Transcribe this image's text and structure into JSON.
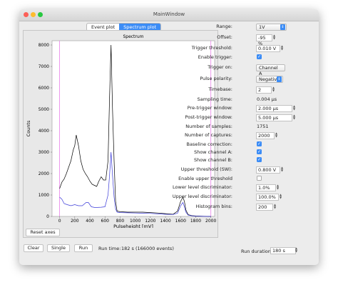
{
  "window": {
    "title": "MainWindow"
  },
  "tabs": [
    {
      "label": "Event plot",
      "active": false
    },
    {
      "label": "Spectrum plot",
      "active": true
    }
  ],
  "chart_data": {
    "type": "line",
    "title": "Spectrum",
    "xlabel": "Pulseheight [mV]",
    "ylabel": "Counts",
    "xlim": [
      -100,
      2050
    ],
    "ylim": [
      0,
      8200
    ],
    "xticks": [
      "0",
      "200",
      "400",
      "600",
      "800",
      "1000",
      "1200",
      "1400",
      "1600",
      "1800",
      "2000"
    ],
    "yticks": [
      "0",
      "1000",
      "2000",
      "3000",
      "4000",
      "5000",
      "6000",
      "7000",
      "8000"
    ],
    "markers": [
      0,
      2000
    ],
    "series": [
      {
        "color": "#000000",
        "x": [
          0,
          30,
          60,
          90,
          120,
          150,
          180,
          200,
          220,
          250,
          280,
          310,
          340,
          370,
          400,
          430,
          460,
          490,
          520,
          550,
          580,
          610,
          640,
          660,
          680,
          700,
          720,
          740,
          760,
          800,
          900,
          1000,
          1100,
          1200,
          1300,
          1400,
          1500,
          1560,
          1600,
          1630,
          1650,
          1670,
          1700,
          1750,
          1800,
          1900,
          2000
        ],
        "y": [
          1300,
          1600,
          1750,
          2000,
          2300,
          2600,
          3100,
          3300,
          3800,
          3300,
          2600,
          2200,
          2000,
          1850,
          1650,
          1500,
          1450,
          1400,
          1650,
          1850,
          1700,
          1700,
          2600,
          5500,
          8000,
          5000,
          2600,
          700,
          250,
          220,
          200,
          200,
          200,
          180,
          160,
          130,
          100,
          250,
          700,
          900,
          700,
          300,
          80,
          40,
          20,
          10,
          0
        ]
      },
      {
        "color": "#3a3ad8",
        "x": [
          0,
          30,
          60,
          100,
          150,
          200,
          250,
          300,
          350,
          380,
          420,
          460,
          500,
          550,
          600,
          640,
          660,
          680,
          700,
          720,
          740,
          760,
          800,
          900,
          1000,
          1100,
          1200,
          1300,
          1400,
          1500,
          1560,
          1600,
          1630,
          1650,
          1670,
          1700,
          1750,
          1800,
          1900,
          2000
        ],
        "y": [
          900,
          800,
          600,
          550,
          500,
          550,
          500,
          500,
          650,
          650,
          450,
          420,
          420,
          430,
          450,
          1000,
          1900,
          3000,
          1900,
          900,
          350,
          200,
          180,
          170,
          160,
          150,
          140,
          120,
          100,
          90,
          150,
          500,
          650,
          450,
          200,
          60,
          30,
          15,
          5,
          0
        ]
      }
    ]
  },
  "plot_buttons": {
    "reset_axes": "Reset axes"
  },
  "bottom": {
    "clear": "Clear",
    "single": "Single",
    "run": "Run",
    "run_time_label": "Run time:",
    "run_time_value": "182 s",
    "run_time_events": "(166000 events)",
    "run_duration_label": "Run duration:",
    "run_duration_value": "180 s"
  },
  "settings": {
    "range": {
      "label": "Range:",
      "value": "1V"
    },
    "offset": {
      "label": "Offset:",
      "value": "-95 %"
    },
    "trigger_threshold": {
      "label": "Trigger threshold:",
      "value": "0.010 V"
    },
    "enable_trigger": {
      "label": "Enable trigger:",
      "checked": true
    },
    "trigger_on": {
      "label": "Trigger on:",
      "value": "Channel A"
    },
    "pulse_polarity": {
      "label": "Pulse polarity:",
      "value": "Negative"
    },
    "timebase": {
      "label": "Timebase:",
      "value": "2"
    },
    "sampling_time": {
      "label": "Sampling time:",
      "value": "0.004 μs"
    },
    "pre_trigger": {
      "label": "Pre-trigger window:",
      "value": "2.000 μs"
    },
    "post_trigger": {
      "label": "Post-trigger window:",
      "value": "5.000 μs"
    },
    "num_samples": {
      "label": "Number of samples:",
      "value": "1751"
    },
    "num_captures": {
      "label": "Number of captures:",
      "value": "2000"
    },
    "baseline_correction": {
      "label": "Baseline correction:",
      "checked": true
    },
    "show_channel_a": {
      "label": "Show channel A:",
      "checked": true
    },
    "show_channel_b": {
      "label": "Show channel B:",
      "checked": true
    },
    "upper_threshold": {
      "label": "Upper threshold (SW):",
      "value": "0.800 V"
    },
    "enable_upper_threshold": {
      "label": "Enable upper threshold",
      "checked": false
    },
    "lower_level_disc": {
      "label": "Lower level discriminator:",
      "value": "1.0%"
    },
    "upper_level_disc": {
      "label": "Upper level discriminator:",
      "value": "100.0%"
    },
    "histogram_bins": {
      "label": "Histogram bins:",
      "value": "200"
    }
  },
  "colors": {
    "accent": "#3b8cf6",
    "close": "#fc5f57",
    "minimize": "#fdbc2e",
    "zoom": "#28c840",
    "marker": "#e880e8"
  }
}
